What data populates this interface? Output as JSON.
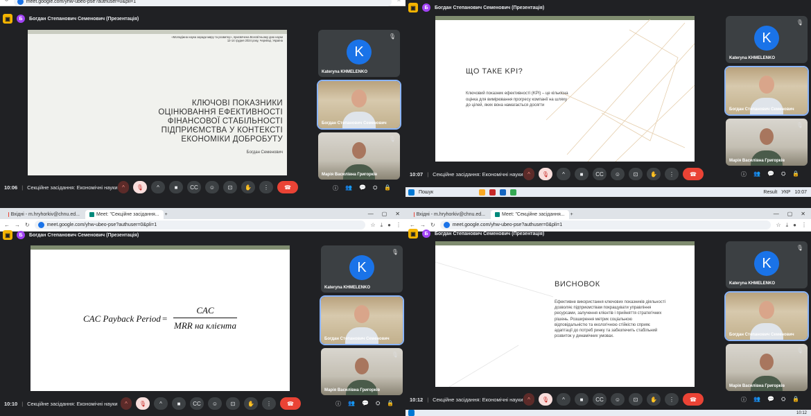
{
  "presenter": "Богдан Степанович Семенович (Презентація)",
  "presenter_initial": "Б",
  "meeting_name": "Секційне засідання: Економічні науки",
  "participants": [
    {
      "name": "Kateryna KHMELENKO",
      "initial": "K"
    },
    {
      "name": "Богдан Степанович Семенович"
    },
    {
      "name": "Марія Василівна Григорків"
    }
  ],
  "participants_count": "4",
  "browser": {
    "tab_gmail": "Вхідні - m.hryhorkiv@chnu.ed...",
    "tab_meet": "Meet: \"Секційне засідання...",
    "url": "meet.google.com/yhw-ubeo-pse?authuser=0&pli=1"
  },
  "taskbar": {
    "search": "Пошук",
    "weather": "Result",
    "lang": "УКР",
    "time1": "10:07",
    "time2": "10:12"
  },
  "quadrants": [
    {
      "time": "10:06",
      "slide": {
        "header_note": "«Молодіжна наука заради миру та розвитку», присвячена Всесвітньому дню науки\n12-14 грудня 2024 року, Чернівці, Україна",
        "title": "КЛЮЧОВІ ПОКАЗНИКИ ОЦІНЮВАННЯ ЕФЕКТИВНОСТІ ФІНАНСОВОЇ СТАБІЛЬНОСТІ ПІДПРИЄМСТВА У КОНТЕКСТІ ЕКОНОМІКИ ДОБРОБУТУ",
        "author": "Богдан Семенович"
      }
    },
    {
      "time": "10:07",
      "slide": {
        "title": "ЩО ТАКЕ KPI?",
        "body": "Ключовий показник ефективності (KPI) – це кількісна оцінка для вимірювання прогресу компанії на шляху до цілей, яких вона намагається досягти"
      }
    },
    {
      "time": "10:10",
      "slide": {
        "lhs": "CAC Payback Period",
        "eq": "=",
        "numerator": "CAC",
        "denominator": "MRR на клієнта"
      }
    },
    {
      "time": "10:12",
      "slide": {
        "title": "ВИСНОВОК",
        "body": "Ефективне використання ключових показників діяльності дозволяє підприємствам покращувати управління ресурсами, залучення клієнтів і прийняття стратегічних рішень. Розширення метрик соціальною відповідальністю та екологічною стійкістю сприяє адаптації до потреб ринку та забезпечить стабільний розвиток у динамічних умовах."
      }
    }
  ]
}
